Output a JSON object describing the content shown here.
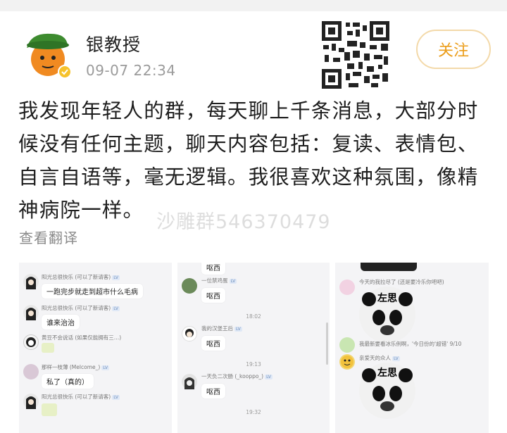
{
  "author": {
    "name": "银教授",
    "timestamp": "09-07 22:34"
  },
  "follow_label": "关注",
  "post_text": "我发现年轻人的群，每天聊上千条消息，大部分时候没有任何主题，聊天内容包括：复读、表情包、自言自语等，毫无逻辑。我很喜欢这种氛围，像精神病院一样。",
  "post_lines": [
    "我发现年轻人的群，每天聊上千条消息，大部分时",
    "候没有任何主题，聊天内容包括：复读、表情包、",
    "自言自语等，毫无逻辑。我很喜欢这种氛围，像精",
    "神病院一样。"
  ],
  "watermark": "沙雕群546370479",
  "translate_label": "查看翻译",
  "chat_a": {
    "rows": [
      {
        "sender": "阳光总很快乐 (可以了新请客)",
        "text": "一跑完步就走到超市什么毛病"
      },
      {
        "sender": "阳光总很快乐 (可以了新请客)",
        "text": "谁来治治"
      },
      {
        "sender": "黄豆不会说话 (如果仅能拥有三…)",
        "text": ""
      },
      {
        "sender": "那样一枝薄 (Melcome_)",
        "text": "私了（真的）"
      },
      {
        "sender": "阳光总很快乐 (可以了新请客)",
        "text": ""
      }
    ]
  },
  "chat_b": {
    "top_text": "呕西",
    "rows": [
      {
        "sender": "一位禁鸡蛋",
        "text": "呕西",
        "time": ""
      },
      {
        "sender": "我的汉堡王后",
        "text": "呕西",
        "time": "18:02"
      },
      {
        "sender": "一天负二次肠 (_kooppo_)",
        "text": "呕西",
        "time": "19:13"
      }
    ],
    "bottom_time": "19:32"
  },
  "chat_c": {
    "rows": [
      {
        "sender": "今天的我拉尽了 (还是要冷乐你吧吧)",
        "caption": "左思"
      },
      {
        "sender": "我最新要看冰乐例啊，'今日份的'超错' 9/10",
        "caption": ""
      },
      {
        "sender": "亲爱天的众人",
        "caption": "左思"
      }
    ]
  },
  "colors": {
    "accent": "#eb9d19",
    "follow_border": "#f3d9a9",
    "time_gray": "#9b9b9b",
    "watermark": "#c8c8c8"
  }
}
